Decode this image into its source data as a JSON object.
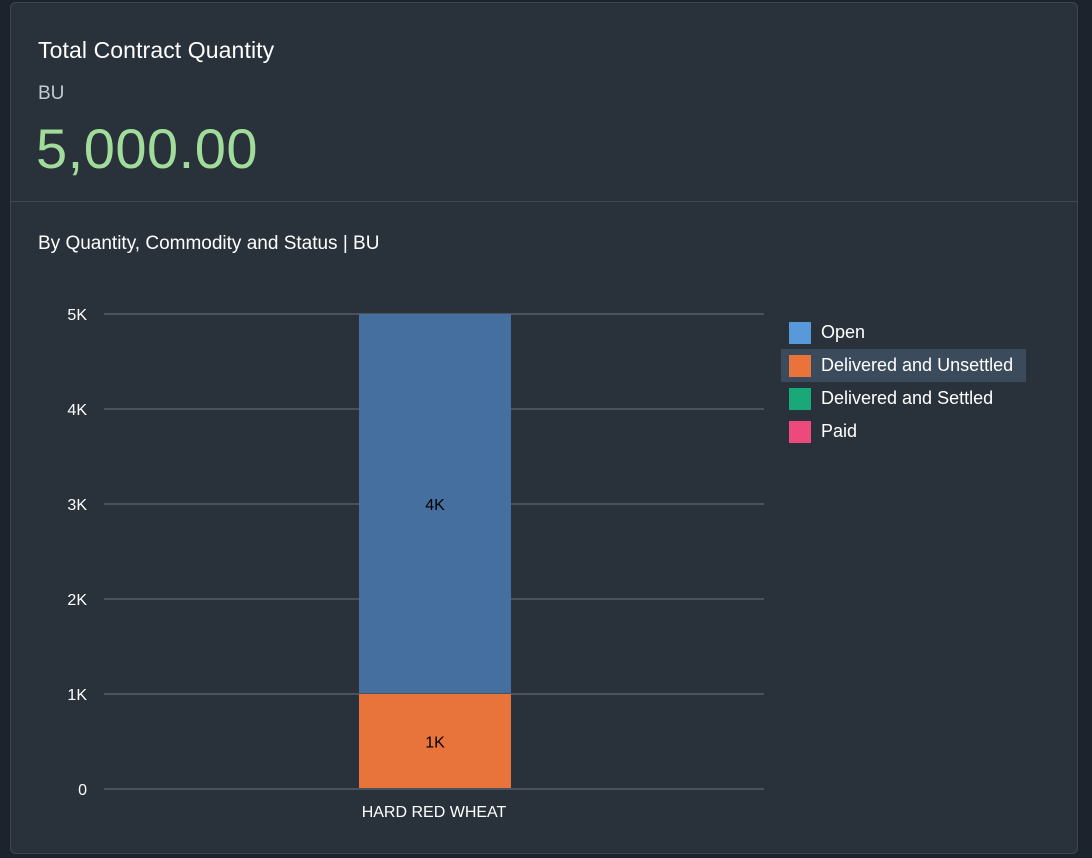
{
  "card": {
    "title": "Total Contract Quantity",
    "unit": "BU",
    "kpi_value": "5,000.00",
    "chart_title": "By Quantity, Commodity and Status | BU"
  },
  "colors": {
    "background": "#29313a",
    "kpi": "#a1dc9a",
    "open": "#456f9e",
    "open_legend": "#5899da",
    "delivered_unsettled": "#e8743b",
    "delivered_settled": "#19a979",
    "paid": "#ed4a7b",
    "gridline": "#6b7580"
  },
  "legend": {
    "items": [
      {
        "label": "Open",
        "color": "#5899da"
      },
      {
        "label": "Delivered and Unsettled",
        "color": "#e8743b",
        "highlighted": true
      },
      {
        "label": "Delivered and Settled",
        "color": "#19a979"
      },
      {
        "label": "Paid",
        "color": "#ed4a7b"
      }
    ]
  },
  "chart_data": {
    "type": "bar",
    "stacked": true,
    "categories": [
      "HARD RED WHEAT"
    ],
    "series": [
      {
        "name": "Delivered and Unsettled",
        "values": [
          1000
        ],
        "color": "#e8743b",
        "data_labels": [
          "1K"
        ]
      },
      {
        "name": "Open",
        "values": [
          4000
        ],
        "color": "#456f9e",
        "data_labels": [
          "4K"
        ]
      },
      {
        "name": "Delivered and Settled",
        "values": [
          0
        ],
        "color": "#19a979"
      },
      {
        "name": "Paid",
        "values": [
          0
        ],
        "color": "#ed4a7b"
      }
    ],
    "title": "By Quantity, Commodity and Status | BU",
    "xlabel": "",
    "ylabel": "",
    "ylim": [
      0,
      5000
    ],
    "yticks": [
      0,
      1000,
      2000,
      3000,
      4000,
      5000
    ],
    "ytick_labels": [
      "0",
      "1K",
      "2K",
      "3K",
      "4K",
      "5K"
    ],
    "grid": true,
    "legend_position": "right"
  }
}
